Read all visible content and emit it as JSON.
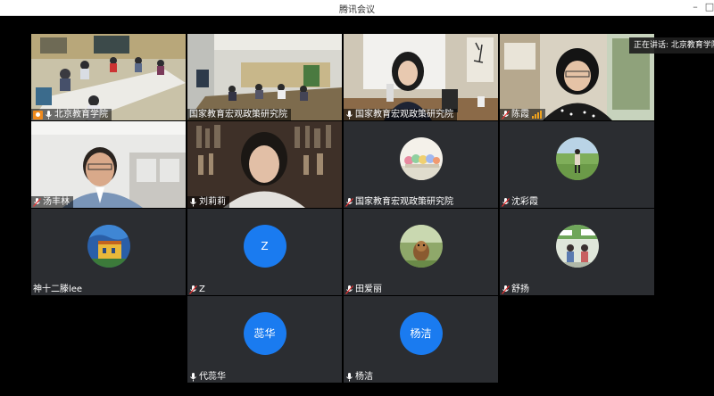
{
  "window": {
    "title": "腾讯会议"
  },
  "speaking_indicator": "正在讲话: 北京教育学院;",
  "tiles": [
    {
      "name": "北京教育学院",
      "host": true
    },
    {
      "name": "国家教育宏观政策研究院"
    },
    {
      "name": "国家教育宏观政策研究院"
    },
    {
      "name": "陈霞"
    },
    {
      "name": "汤丰林"
    },
    {
      "name": "刘莉莉"
    },
    {
      "name": "国家教育宏观政策研究院"
    },
    {
      "name": "沈彩霞"
    },
    {
      "name": "神十二滕lee"
    },
    {
      "name": "Z",
      "avatar_text": "Z"
    },
    {
      "name": "田爱丽"
    },
    {
      "name": "舒扬"
    },
    {
      "name": "代蕊华",
      "avatar_text": "蕊华"
    },
    {
      "name": "杨洁",
      "avatar_text": "杨洁"
    }
  ]
}
